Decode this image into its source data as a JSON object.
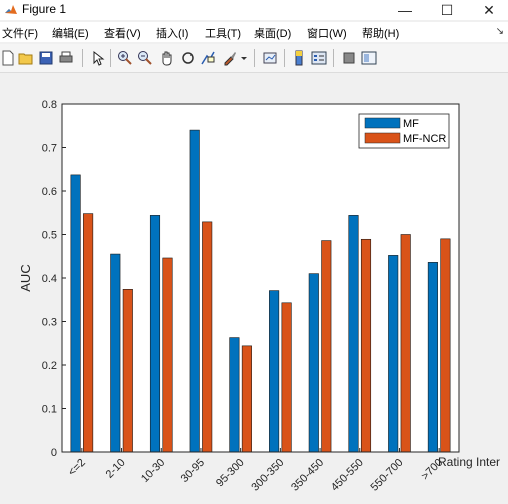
{
  "window": {
    "title": "Figure 1"
  },
  "window_controls": {
    "minimize": "—",
    "maximize": "☐",
    "close": "✕"
  },
  "menu": {
    "items": [
      {
        "label": "文件(F)"
      },
      {
        "label": "编辑(E)"
      },
      {
        "label": "查看(V)"
      },
      {
        "label": "插入(I)"
      },
      {
        "label": "工具(T)"
      },
      {
        "label": "桌面(D)"
      },
      {
        "label": "窗口(W)"
      },
      {
        "label": "帮助(H)"
      }
    ],
    "overflow": "↘"
  },
  "toolbar": {
    "icons": [
      "new-figure-icon",
      "open-icon",
      "save-icon",
      "print-icon",
      "pointer-icon",
      "zoom-in-icon",
      "zoom-out-icon",
      "pan-hand-icon",
      "rotate-3d-icon",
      "data-cursor-icon",
      "brush-icon",
      "brush-dropdown-icon",
      "link-plot-icon",
      "colorbar-icon",
      "legend-icon",
      "hide-plot-tools-icon",
      "show-plot-tools-icon"
    ]
  },
  "colors": {
    "mf": "#0072bd",
    "mf_ncr": "#d95319",
    "axes_bg": "#ffffff",
    "figure_bg": "#f0f0f0"
  },
  "chart_data": {
    "type": "bar",
    "title": "",
    "xlabel": "Rating Inter",
    "ylabel": "AUC",
    "ylim": [
      0,
      0.8
    ],
    "yticks": [
      "0",
      "0.1",
      "0.2",
      "0.3",
      "0.4",
      "0.5",
      "0.6",
      "0.7",
      "0.8"
    ],
    "grid": false,
    "legend_position": "top-right",
    "categories": [
      "<=2",
      "2-10",
      "10-30",
      "30-95",
      "95-300",
      "300-350",
      "350-450",
      "450-550",
      "550-700",
      ">700"
    ],
    "series": [
      {
        "name": "MF",
        "color": "#0072bd",
        "values": [
          0.637,
          0.455,
          0.544,
          0.74,
          0.263,
          0.371,
          0.41,
          0.544,
          0.452,
          0.436
        ]
      },
      {
        "name": "MF-NCR",
        "color": "#d95319",
        "values": [
          0.548,
          0.374,
          0.446,
          0.529,
          0.244,
          0.343,
          0.486,
          0.489,
          0.5,
          0.49
        ]
      }
    ]
  }
}
